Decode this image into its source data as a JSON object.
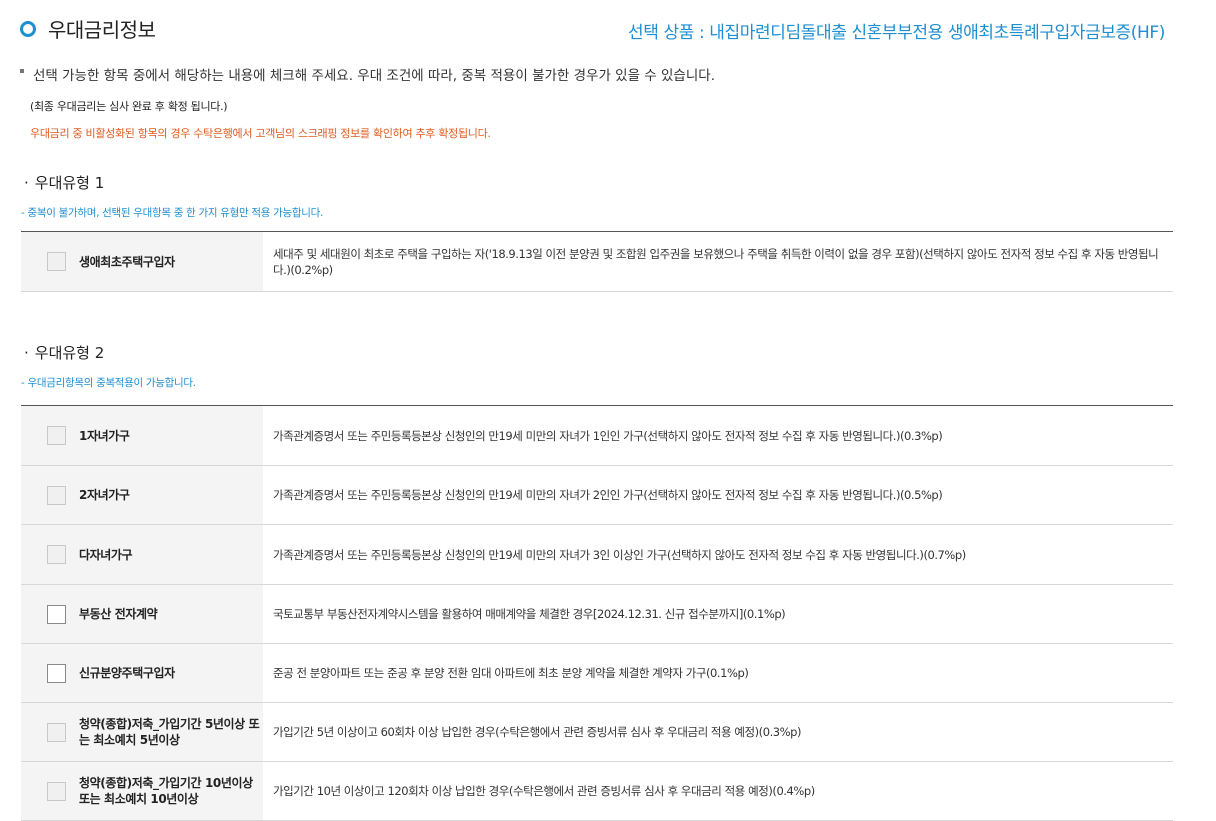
{
  "header": {
    "title": "우대금리정보",
    "selected_product": "선택 상품 : 내집마련디딤돌대출 신혼부부전용 생애최초특례구입자금보증(HF)"
  },
  "notice": "선택 가능한 항목 중에서 해당하는 내용에 체크해 주세요. 우대 조건에 따라, 중복 적용이 불가한 경우가 있을 수 있습니다.",
  "final_rate_note": "(최종 우대금리는 심사 완료 후 확정 됩니다.)",
  "inactive_note": "우대금리 중 비활성화된 항목의 경우 수탁은행에서 고객님의 스크래핑 정보를 확인하여 추후 확정됩니다.",
  "sections": [
    {
      "title": "우대유형 1",
      "desc": "- 중복이 불가하며, 선택된 우대항목 중 한 가지 유형만 적용 가능합니다.",
      "items": [
        {
          "label": "생애최초주택구입자",
          "desc": "세대주 및 세대원이 최초로 주택을 구입하는 자('18.9.13일 이전 분양권 및 조합원 입주권을 보유했으나 주택을 취득한 이력이 없을 경우 포함)(선택하지 않아도 전자적 정보 수집 후 자동 반영됩니다.)(0.2%p)",
          "enabled": false
        }
      ]
    },
    {
      "title": "우대유형 2",
      "desc": "- 우대금리항목의 중복적용이 가능합니다.",
      "items": [
        {
          "label": "1자녀가구",
          "desc": "가족관계증명서 또는 주민등록등본상 신청인의 만19세 미만의 자녀가 1인인 가구(선택하지 않아도 전자적 정보 수집 후 자동 반영됩니다.)(0.3%p)",
          "enabled": false
        },
        {
          "label": "2자녀가구",
          "desc": "가족관계증명서 또는 주민등록등본상 신청인의 만19세 미만의 자녀가 2인인 가구(선택하지 않아도 전자적 정보 수집 후 자동 반영됩니다.)(0.5%p)",
          "enabled": false
        },
        {
          "label": "다자녀가구",
          "desc": "가족관계증명서 또는 주민등록등본상 신청인의 만19세 미만의 자녀가 3인 이상인 가구(선택하지 않아도 전자적 정보 수집 후 자동 반영됩니다.)(0.7%p)",
          "enabled": false
        },
        {
          "label": "부동산 전자계약",
          "desc": "국토교통부 부동산전자계약시스템을 활용하여 매매계약을 체결한 경우[2024.12.31. 신규 접수분까지](0.1%p)",
          "enabled": true
        },
        {
          "label": "신규분양주택구입자",
          "desc": "준공 전 분양아파트 또는 준공 후 분양 전환 임대 아파트에 최초 분양 계약을 체결한 계약자 가구(0.1%p)",
          "enabled": true
        },
        {
          "label": "청약(종합)저축_가입기간 5년이상 또는 최소예치 5년이상",
          "desc": "가입기간 5년 이상이고 60회차 이상 납입한 경우(수탁은행에서 관련 증빙서류 심사 후 우대금리 적용 예정)(0.3%p)",
          "enabled": false
        },
        {
          "label": "청약(종합)저축_가입기간 10년이상 또는 최소예치 10년이상",
          "desc": "가입기간 10년 이상이고 120회차 이상 납입한 경우(수탁은행에서 관련 증빙서류 심사 후 우대금리 적용 예정)(0.4%p)",
          "enabled": false
        }
      ]
    }
  ]
}
